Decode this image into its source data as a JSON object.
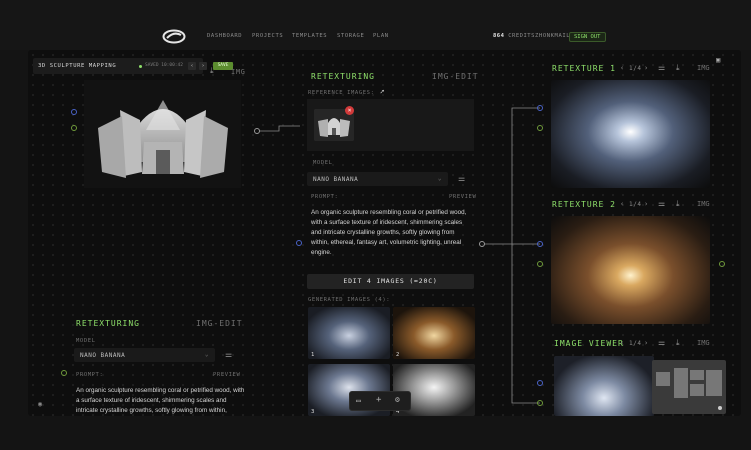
{
  "nav": {
    "items": [
      {
        "label": "DASHBOARD"
      },
      {
        "label": "PROJECTS"
      },
      {
        "label": "TEMPLATES"
      },
      {
        "label": "STORAGE"
      },
      {
        "label": "PLAN"
      }
    ],
    "credits_value": "864",
    "credits_label": "CREDITS",
    "user": "ZHONKMAIL",
    "signout": "SIGN OUT"
  },
  "project": {
    "title": "3D SCULPTURE MAPPING",
    "saved": "SAVED 10:00:42",
    "save": "SAVE",
    "img_tab": "IMG"
  },
  "left_node": {
    "tab_active": "RETEXTURING",
    "tab_inactive": "IMG-EDIT",
    "model_label": "MODEL",
    "model_value": "NANO BANANA",
    "prompt_label": "PROMPT:",
    "preview_label": "PREVIEW",
    "prompt_text": "An organic sculpture resembling coral or petrified wood, with a surface texture of iridescent, shimmering scales and intricate crystalline growths, softly glowing from within, ethereal, fantasy art, volumetric lighting, unreal"
  },
  "center_node": {
    "tab_active": "RETEXTURING",
    "tab_inactive": "IMG-EDIT",
    "ref_label": "REFERENCE IMAGES:",
    "model_label": "MODEL",
    "model_value": "NANO BANANA",
    "prompt_label": "PROMPT:",
    "preview_label": "PREVIEW",
    "prompt_text": "An organic sculpture resembling coral or petrified wood, with a surface texture of iridescent, shimmering scales and intricate crystalline growths, softly glowing from within, ethereal, fantasy art, volumetric lighting, unreal engine.",
    "edit_button": "EDIT 4 IMAGES (≈20C)",
    "generated_label": "GENERATED IMAGES (4):",
    "thumbs": [
      "1",
      "2",
      "3",
      "4"
    ]
  },
  "right_nodes": [
    {
      "title": "RETEXTURE 1",
      "pager": "1/4",
      "img": "IMG"
    },
    {
      "title": "RETEXTURE 2",
      "pager": "1/4",
      "img": "IMG"
    },
    {
      "title": "IMAGE VIEWER",
      "pager": "1/4",
      "img": "IMG"
    }
  ],
  "colors": {
    "accent": "#8ee06a",
    "blue_port": "#4a63c8",
    "green_port": "#6f9a3a"
  }
}
